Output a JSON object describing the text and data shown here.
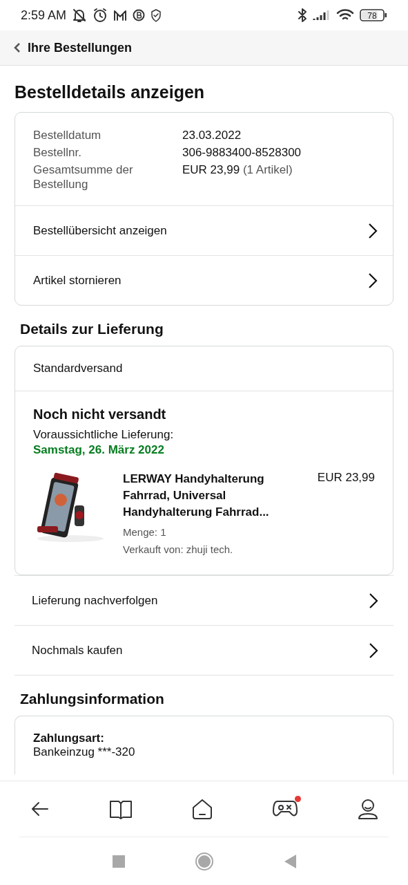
{
  "status_bar": {
    "time": "2:59 AM",
    "battery": "78"
  },
  "header": {
    "back_label": "Ihre Bestellungen"
  },
  "title": "Bestelldetails anzeigen",
  "order_info": [
    {
      "label": "Bestelldatum",
      "value": "23.03.2022"
    },
    {
      "label": "Bestellnr.",
      "value": "306-9883400-8528300"
    },
    {
      "label": "Gesamtsumme der Bestellung",
      "value": "EUR 23,99",
      "note": "(1 Artikel)"
    }
  ],
  "order_links": [
    "Bestellübersicht anzeigen",
    "Artikel stornieren"
  ],
  "delivery": {
    "heading": "Details zur Lieferung",
    "method": "Standardversand",
    "status": "Noch nicht versandt",
    "eta_label": "Voraussichtliche Lieferung:",
    "eta_date": "Samstag, 26. März 2022",
    "item": {
      "kind": "picture",
      "title": "LERWAY Handyhalterung Fahrrad, Universal Handyhalterung Fahrrad...",
      "price": "EUR 23,99",
      "quantity": "Menge: 1",
      "seller": "Verkauft von: zhuji tech."
    }
  },
  "delivery_links": [
    "Lieferung nachverfolgen",
    "Nochmals kaufen"
  ],
  "payment": {
    "heading": "Zahlungsinformation",
    "label": "Zahlungsart:",
    "value": "Bankeinzug ***-320"
  },
  "bottom_nav": [
    {
      "kind": "back",
      "selected": false,
      "badge": false
    },
    {
      "kind": "book",
      "selected": false,
      "badge": false
    },
    {
      "kind": "home",
      "selected": false,
      "badge": false
    },
    {
      "kind": "gamepad",
      "selected": false,
      "badge": true
    },
    {
      "kind": "person",
      "selected": false,
      "badge": false
    }
  ]
}
